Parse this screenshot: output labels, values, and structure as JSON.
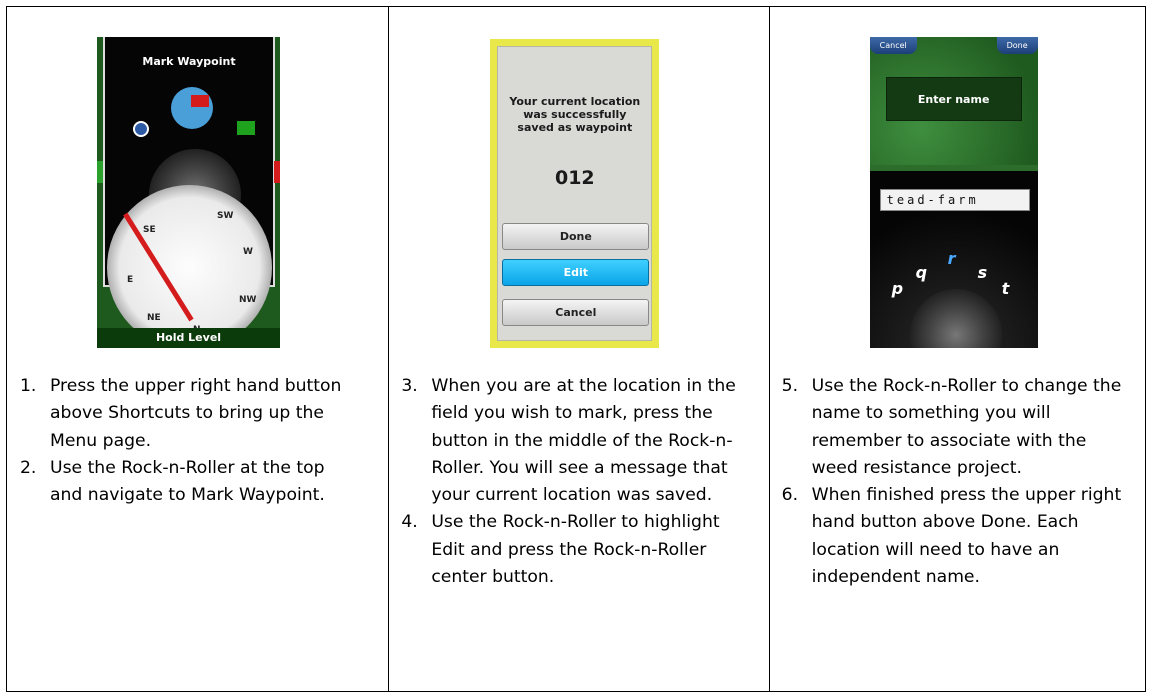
{
  "screens": {
    "mark_waypoint": {
      "title": "Mark Waypoint",
      "compass_dirs": [
        "SE",
        "SW",
        "W",
        "E",
        "NE",
        "NW",
        "N"
      ],
      "footer": "Hold Level"
    },
    "saved": {
      "message": "Your current location was successfully saved as waypoint",
      "waypoint_number": "012",
      "buttons": [
        "Done",
        "Edit",
        "Cancel"
      ],
      "selected_button": "Edit"
    },
    "enter_name": {
      "cancel_label": "Cancel",
      "done_label": "Done",
      "prompt": "Enter name",
      "entry_value": "tead-farm",
      "roller_letters": [
        "p",
        "q",
        "r",
        "s",
        "t"
      ],
      "selected_letter": "r"
    }
  },
  "instructions": {
    "col1": [
      {
        "num": "1.",
        "text": "Press the upper right hand button above Shortcuts to bring up the Menu page."
      },
      {
        "num": "2.",
        "text": "Use the Rock-n-Roller at the top and navigate to Mark Waypoint."
      }
    ],
    "col2": [
      {
        "num": "3.",
        "text": "When you are at the location in the field you wish to mark, press the button in the middle of the Rock-n-Roller. You will see a message that your current location was saved."
      },
      {
        "num": "4.",
        "text": "Use the Rock-n-Roller to highlight Edit and press the Rock-n-Roller center button."
      }
    ],
    "col3": [
      {
        "num": "5.",
        "text": "Use the Rock-n-Roller to change the name to something you will remember to associate with the weed resistance project."
      },
      {
        "num": "6.",
        "text": "When finished press the upper right hand button above Done.  Each location will need to have an independent name."
      }
    ]
  }
}
